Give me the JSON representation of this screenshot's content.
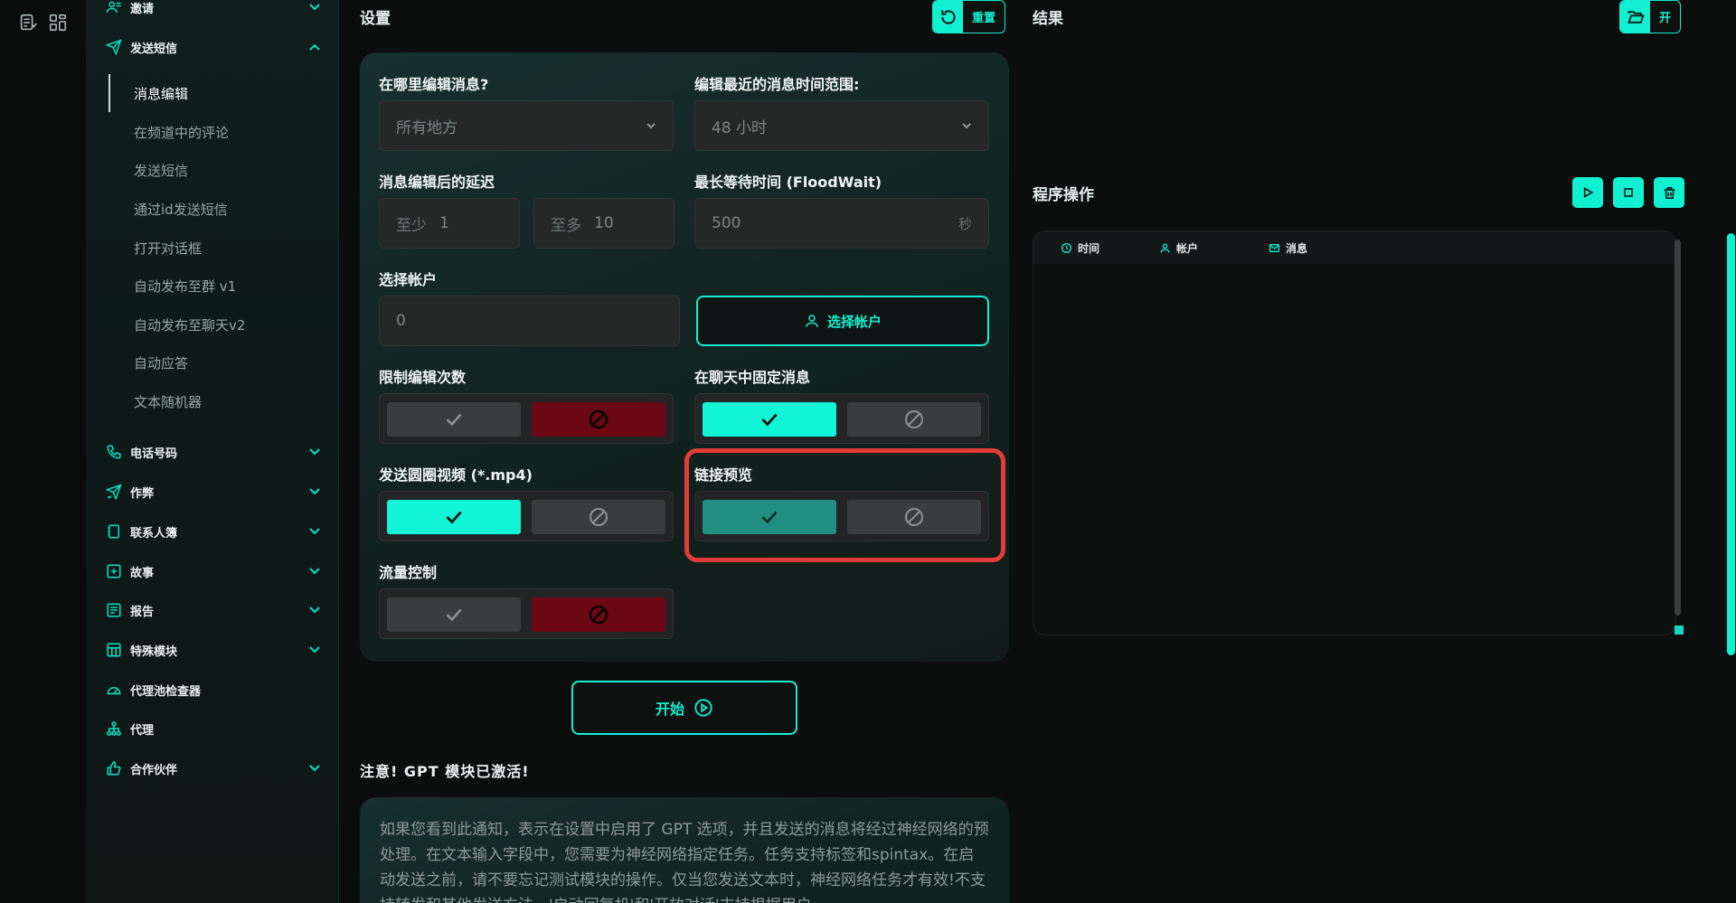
{
  "sidebar": {
    "items": [
      {
        "label": "邀请",
        "icon": "user-group-icon"
      },
      {
        "label": "发送短信",
        "icon": "send-icon"
      },
      {
        "label": "电话号码",
        "icon": "phone-icon"
      },
      {
        "label": "作弊",
        "icon": "send-check-icon"
      },
      {
        "label": "联系人簿",
        "icon": "contacts-book-icon"
      },
      {
        "label": "故事",
        "icon": "plus-square-icon"
      },
      {
        "label": "报告",
        "icon": "report-icon"
      },
      {
        "label": "特殊模块",
        "icon": "table-icon"
      },
      {
        "label": "代理池检查器",
        "icon": "gauge-icon"
      },
      {
        "label": "代理",
        "icon": "network-icon"
      },
      {
        "label": "合作伙伴",
        "icon": "thumbs-up-icon"
      }
    ],
    "subitems": [
      "消息编辑",
      "在频道中的评论",
      "发送短信",
      "通过id发送短信",
      "打开对话框",
      "自动发布至群 v1",
      "自动发布至聊天v2",
      "自动应答",
      "文本随机器"
    ]
  },
  "settings": {
    "title": "设置",
    "reset_label": "重置",
    "edit_where_label": "在哪里编辑消息?",
    "edit_where_value": "所有地方",
    "time_range_label": "编辑最近的消息时间范围:",
    "time_range_value": "48 小时",
    "delay_label": "消息编辑后的延迟",
    "delay_min_prefix": "至少",
    "delay_min_value": "1",
    "delay_max_prefix": "至多",
    "delay_max_value": "10",
    "floodwait_label": "最长等待时间 (FloodWait)",
    "floodwait_value": "500",
    "floodwait_unit": "秒",
    "accounts_label": "选择帐户",
    "accounts_value": "0",
    "choose_accounts_button": "选择帐户",
    "limit_edits_label": "限制编辑次数",
    "pin_label": "在聊天中固定消息",
    "circle_video_label": "发送圆圈视频 (*.mp4)",
    "link_preview_label": "链接预览",
    "flow_control_label": "流量控制",
    "start_button": "开始"
  },
  "notice": {
    "title": "注意! GPT 模块已激活!",
    "body": "如果您看到此通知，表示在设置中启用了 GPT 选项，并且发送的消息将经过神经网络的预处理。在文本输入字段中，您需要为神经网络指定任务。任务支持标签和spintax。在启动发送之前，请不要忘记测试模块的操作。仅当您发送文本时，神经网络任务才有效!不支持转发和其他发送方法，'启动回复机'和'开放对话'支持根据用户"
  },
  "results": {
    "title": "结果",
    "open_label": "开",
    "ops_title": "程序操作",
    "columns": [
      "时间",
      "帐户",
      "消息"
    ]
  },
  "colors": {
    "accent": "#11f0d1",
    "deny": "#6b0813",
    "highlight": "#e33b36"
  }
}
